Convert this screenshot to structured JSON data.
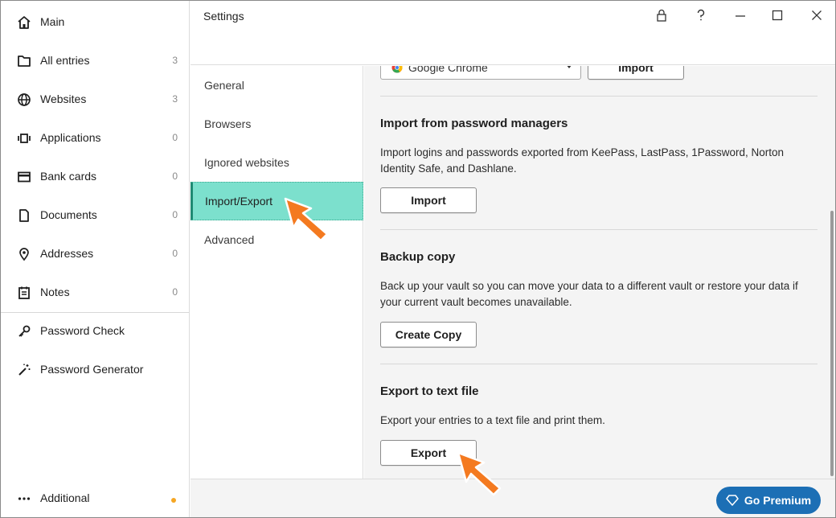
{
  "sidebar": {
    "items": [
      {
        "label": "Main",
        "count": "",
        "icon": "home-icon"
      },
      {
        "label": "All entries",
        "count": "3",
        "icon": "folder-icon"
      },
      {
        "label": "Websites",
        "count": "3",
        "icon": "globe-icon"
      },
      {
        "label": "Applications",
        "count": "0",
        "icon": "applications-icon"
      },
      {
        "label": "Bank cards",
        "count": "0",
        "icon": "card-icon"
      },
      {
        "label": "Documents",
        "count": "0",
        "icon": "document-icon"
      },
      {
        "label": "Addresses",
        "count": "0",
        "icon": "location-icon"
      },
      {
        "label": "Notes",
        "count": "0",
        "icon": "notes-icon"
      }
    ],
    "tools": [
      {
        "label": "Password Check",
        "icon": "key-icon"
      },
      {
        "label": "Password Generator",
        "icon": "magic-wand-icon"
      }
    ],
    "additional": {
      "label": "Additional",
      "icon": "more-dots-icon"
    }
  },
  "window": {
    "title": "Settings"
  },
  "settings_nav": {
    "items": [
      {
        "label": "General"
      },
      {
        "label": "Browsers"
      },
      {
        "label": "Ignored websites"
      },
      {
        "label": "Import/Export",
        "active": true
      },
      {
        "label": "Advanced"
      }
    ]
  },
  "content": {
    "browser_select": {
      "value": "Google Chrome"
    },
    "browser_import_button": "Import",
    "sections": [
      {
        "title": "Import from password managers",
        "description": "Import logins and passwords exported from KeePass, LastPass, 1Password, Norton Identity Safe, and Dashlane.",
        "button": "Import"
      },
      {
        "title": "Backup copy",
        "description": "Back up your vault so you can move your data to a different vault or restore your data if your current vault becomes unavailable.",
        "button": "Create Copy"
      },
      {
        "title": "Export to text file",
        "description": "Export your entries to a text file and print them.",
        "button": "Export"
      }
    ]
  },
  "footer": {
    "premium_label": "Go Premium"
  },
  "colors": {
    "active_nav": "#7ce0cd",
    "premium": "#1c6fb5",
    "arrow": "#f47a20",
    "badge": "#f5a623"
  }
}
